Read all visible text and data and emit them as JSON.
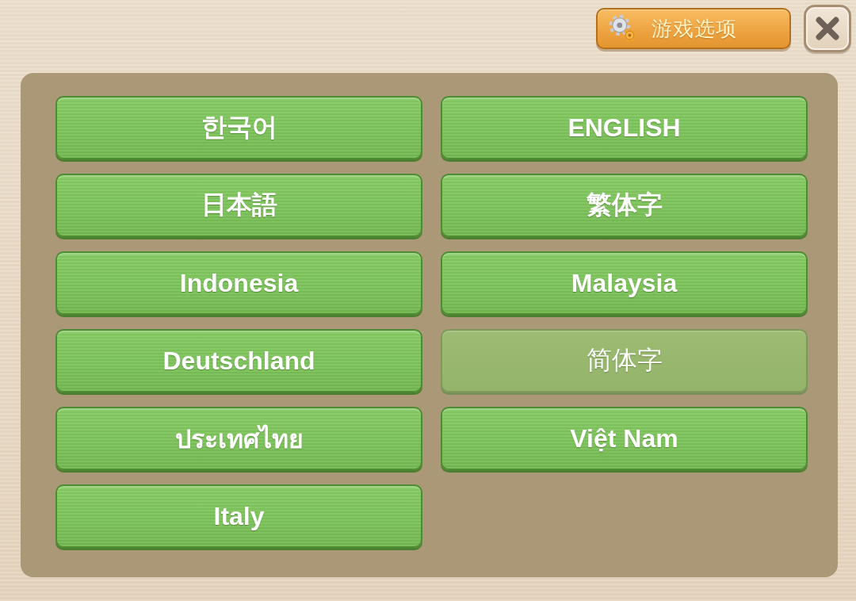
{
  "header": {
    "options_button": {
      "label": "游戏选项"
    }
  },
  "languages": [
    {
      "label": "한국어",
      "selected": false
    },
    {
      "label": "ENGLISH",
      "selected": false
    },
    {
      "label": "日本語",
      "selected": false
    },
    {
      "label": "繁体字",
      "selected": false
    },
    {
      "label": "Indonesia",
      "selected": false
    },
    {
      "label": "Malaysia",
      "selected": false
    },
    {
      "label": "Deutschland",
      "selected": false
    },
    {
      "label": "简体字",
      "selected": true
    },
    {
      "label": "ประเทศไทย",
      "selected": false
    },
    {
      "label": "Việt Nam",
      "selected": false
    },
    {
      "label": "Italy",
      "selected": false
    }
  ]
}
